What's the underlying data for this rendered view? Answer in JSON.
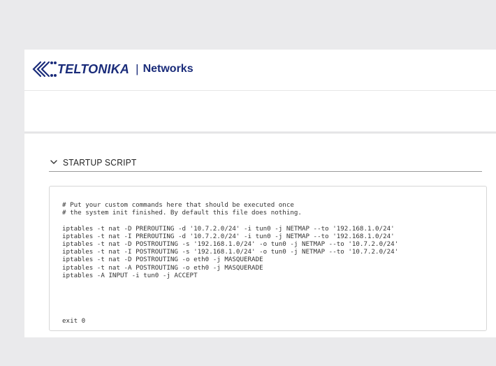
{
  "header": {
    "brand": "TELTONIKA",
    "separator": "|",
    "product": "Networks",
    "brand_color": "#1a2c7a"
  },
  "section": {
    "title": "STARTUP SCRIPT",
    "collapse_icon": "chevron-down-icon"
  },
  "script": {
    "body": "# Put your custom commands here that should be executed once\n# the system init finished. By default this file does nothing.\n\niptables -t nat -D PREROUTING -d '10.7.2.0/24' -i tun0 -j NETMAP --to '192.168.1.0/24'\niptables -t nat -I PREROUTING -d '10.7.2.0/24' -i tun0 -j NETMAP --to '192.168.1.0/24'\niptables -t nat -D POSTROUTING -s '192.168.1.0/24' -o tun0 -j NETMAP --to '10.7.2.0/24'\niptables -t nat -I POSTROUTING -s '192.168.1.0/24' -o tun0 -j NETMAP --to '10.7.2.0/24'\niptables -t nat -D POSTROUTING -o eth0 -j MASQUERADE\niptables -t nat -A POSTROUTING -o eth0 -j MASQUERADE\niptables -A INPUT -i tun0 -j ACCEPT",
    "footer_line": "exit 0"
  }
}
